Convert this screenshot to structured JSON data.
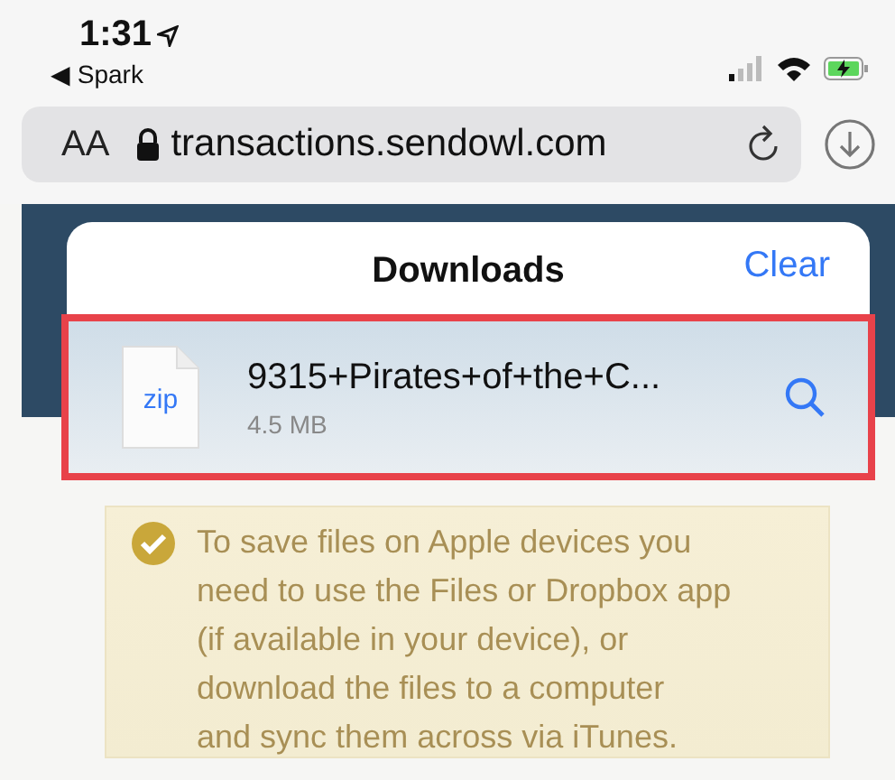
{
  "status_bar": {
    "time": "1:31",
    "back_app": "◀ Spark"
  },
  "address_bar": {
    "text_size": "AA",
    "url": "transactions.sendowl.com"
  },
  "downloads_popover": {
    "title": "Downloads",
    "clear": "Clear",
    "items": [
      {
        "kind": "zip",
        "file_type": "zip",
        "name": "9315+Pirates+of+the+C...",
        "size": "4.5 MB",
        "highlighted": true
      }
    ]
  },
  "notice": {
    "lines": [
      "To save files on Apple devices you",
      "need to use the Files or Dropbox app",
      "(if available in your device), or",
      "download the files to a computer",
      "and sync them across via iTunes."
    ]
  }
}
